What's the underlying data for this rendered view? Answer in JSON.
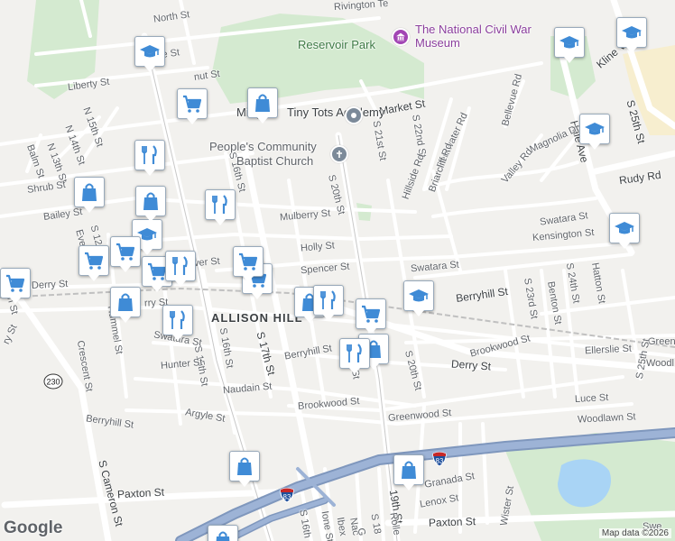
{
  "map": {
    "colors": {
      "background": "#f2f1ee",
      "park": "#d4ead0",
      "water": "#a9d4f5",
      "highway": "#8aa2c6",
      "major_road": "#ffffff",
      "minor_road": "#ffffff",
      "rail": "#b9b9b9"
    },
    "labels": {
      "area": "ALLISON HILL",
      "poi_museum": "The National Civil War Museum",
      "poi_park": "Reservoir Park",
      "poi_academy": "Tiny Tots Academy",
      "poi_academy_prefix": "Mingers",
      "poi_church_line1": "People's Community",
      "poi_church_line2": "Baptist Church",
      "kline_village": "Kline Village"
    },
    "streets": {
      "rivington": "Rivington Te",
      "north_st": "North St",
      "state_st": "State St",
      "walnut_st": "nut St",
      "liberty_st": "Liberty St",
      "market_st": "Market St",
      "n_15th": "N 15th St",
      "n_14th": "N 14th St",
      "n_13th": "N 13th St",
      "balm_st": "Balm St",
      "shrub_st": "Shrub St",
      "bailey_st": "Bailey St",
      "mulberry_st": "Mulberry St",
      "holly_st": "Holly St",
      "spencer_st": "Spencer St",
      "derry_st": "Derry St",
      "derry_st_left": "Derry St",
      "derry_st_right": "Derry St",
      "swatara_st": "Swatara St",
      "swatara_st_mid": "Swatara St",
      "swatara_st_right": "Swatara St",
      "kensington_st": "Kensington St",
      "berryhill_st": "Berryhill St",
      "berryhill_st_mid": "Berryhill St",
      "berryhill_st_left": "Berryhill St",
      "brookwood_st": "Brookwood St",
      "brookwood_st_left": "Brookwood St",
      "ellerslie_st": "Ellerslie St",
      "luce_st": "Luce St",
      "woodlawn_st": "Woodlawn St",
      "greenwood_st": "Greenwood St",
      "s_17th": "S 17th St",
      "s_16th": "S 16th St",
      "s_16th_b": "S 16th St",
      "s_15th": "S 15th St",
      "s_18th": "S 18th St",
      "s_19th": "19th St",
      "s_20th": "S 20th St",
      "s_20th_b": "S 20th St",
      "s_21st": "S 21st St",
      "s_22nd": "S 22nd St",
      "s_23rd": "S 23rd St",
      "s_24th": "S 24th St",
      "s_25th": "S 25th St",
      "s_25th_top": "S 25th St",
      "s_cameron": "S Cameron St",
      "cameron_left": "on St",
      "hummel": "Hummel St",
      "crescent": "Crescent St",
      "hunter_st": "Hunter St",
      "naudain_st": "Naudain St",
      "argyle_st": "Argyle St",
      "paxton_st": "Paxton St",
      "paxton_st_right": "Paxton St",
      "hale_ave": "Hale Ave",
      "rudy_rd": "Rudy Rd",
      "magnolia_dr": "Magnolia Dr",
      "valley_rd": "Valley Rd",
      "bellevue_rd": "Bellevue Rd",
      "pentwater_rd": "Pentwater Rd",
      "briarcliff_rd": "Briarcliff Rd",
      "hillside_rd": "Hillside Rd",
      "benton_st": "Benton St",
      "hatton_st": "Hatton St",
      "wister_st": "Wister St",
      "lenox_st": "Lenox St",
      "granada_st": "Granada St",
      "woodl_right": "Woodl",
      "green_right": "Green",
      "ry_st": "ry St",
      "rry_st": "rry St",
      "ever_st": "ver St",
      "ione_st": "Ione St",
      "ibex": "Ibex",
      "s_18_bottom": "S 18",
      "rolls": "Rolle",
      "s_16th_bottom": "S 16th",
      "s_12": "S 12",
      "eve": "Eve",
      "s_ke": "ke St",
      "nac": "Nac",
      "g_st": "G",
      "swe": "Swe"
    },
    "highway_shields": [
      {
        "label": "230",
        "kind": "state"
      },
      {
        "label": "83",
        "kind": "interstate"
      },
      {
        "label": "83",
        "kind": "interstate"
      }
    ],
    "markers": [
      {
        "icon": "graduation-cap-icon",
        "color": "#3f8bd6"
      },
      {
        "icon": "shopping-cart-icon",
        "color": "#3f8bd6"
      },
      {
        "icon": "shopping-bag-icon",
        "color": "#3f8bd6"
      },
      {
        "icon": "restaurant-icon",
        "color": "#3f8bd6"
      }
    ],
    "attribution": "Map data ©2026",
    "logo": "Google"
  }
}
